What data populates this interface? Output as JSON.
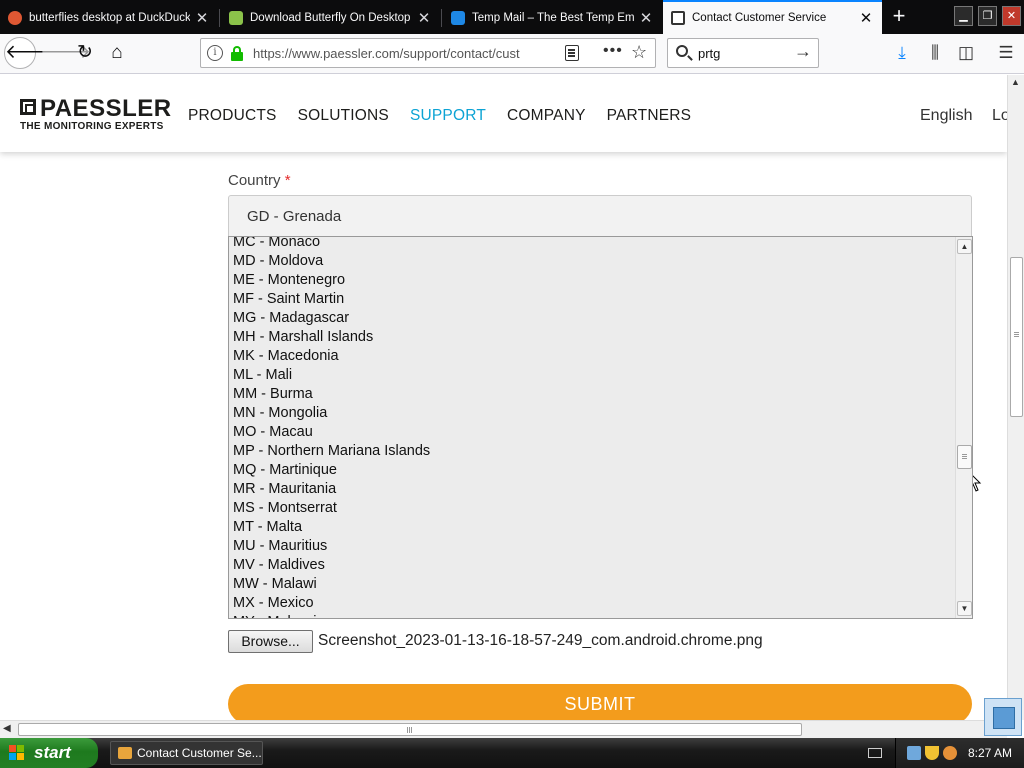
{
  "browser": {
    "tabs": [
      {
        "title": "butterflies desktop at DuckDuckGo",
        "favicon": "duckduckgo-icon",
        "active": false
      },
      {
        "title": "Download Butterfly On Desktop Fr",
        "favicon": "butterfly-site-icon",
        "active": false
      },
      {
        "title": "Temp Mail – The Best Temp Email",
        "favicon": "temp-mail-icon",
        "active": false
      },
      {
        "title": "Contact Customer Service",
        "favicon": "paessler-icon",
        "active": true
      }
    ],
    "url": "https://www.paessler.com/support/contact/cust",
    "search_query": "prtg",
    "accent_color": "#0a84ff"
  },
  "site": {
    "logo_name": "PAESSLER",
    "logo_tagline": "THE MONITORING EXPERTS",
    "nav": [
      {
        "label": "PRODUCTS",
        "active": false
      },
      {
        "label": "SOLUTIONS",
        "active": false
      },
      {
        "label": "SUPPORT",
        "active": true
      },
      {
        "label": "COMPANY",
        "active": false
      },
      {
        "label": "PARTNERS",
        "active": false
      }
    ],
    "language": "English",
    "login": "Lo",
    "active_color": "#0ca3d4"
  },
  "form": {
    "country_label": "Country",
    "required_mark": "*",
    "country_selected": "GD - Grenada",
    "country_options": [
      "MC - Monaco",
      "MD - Moldova",
      "ME - Montenegro",
      "MF - Saint Martin",
      "MG - Madagascar",
      "MH - Marshall Islands",
      "MK - Macedonia",
      "ML - Mali",
      "MM - Burma",
      "MN - Mongolia",
      "MO - Macau",
      "MP - Northern Mariana Islands",
      "MQ - Martinique",
      "MR - Mauritania",
      "MS - Montserrat",
      "MT - Malta",
      "MU - Mauritius",
      "MV - Maldives",
      "MW - Malawi",
      "MX - Mexico",
      "MY - Malaysia"
    ],
    "browse_label": "Browse...",
    "file_name": "Screenshot_2023-01-13-16-18-57-249_com.android.chrome.png",
    "submit_label": "SUBMIT",
    "submit_color": "#f39c1c"
  },
  "taskbar": {
    "start_label": "start",
    "task_label": "Contact Customer Se...",
    "clock": "8:27 AM"
  }
}
